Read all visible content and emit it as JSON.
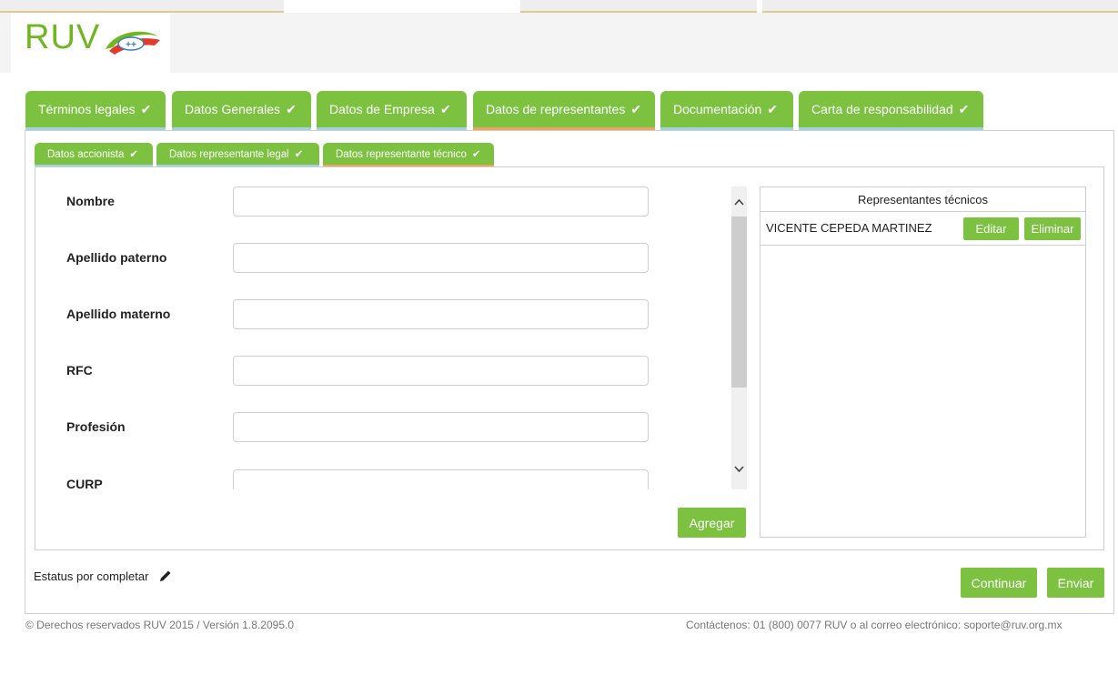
{
  "header": {
    "logo_text": "RUV",
    "logo_badge": "++"
  },
  "main_tabs": [
    {
      "label": "Términos legales",
      "check": "✔"
    },
    {
      "label": "Datos Generales",
      "check": "✔"
    },
    {
      "label": "Datos de Empresa",
      "check": "✔"
    },
    {
      "label": "Datos de representantes",
      "check": "✔",
      "active": true
    },
    {
      "label": "Documentación",
      "check": "✔"
    },
    {
      "label": "Carta de responsabilidad",
      "check": "✔"
    }
  ],
  "sub_tabs": [
    {
      "label": "Datos accionista",
      "check": "✔"
    },
    {
      "label": "Datos representante legal",
      "check": "✔"
    },
    {
      "label": "Datos representante técnico",
      "check": "✔",
      "active": true
    }
  ],
  "form": {
    "fields": [
      {
        "label": "Nombre",
        "value": ""
      },
      {
        "label": "Apellido paterno",
        "value": ""
      },
      {
        "label": "Apellido materno",
        "value": ""
      },
      {
        "label": "RFC",
        "value": ""
      },
      {
        "label": "Profesión",
        "value": ""
      },
      {
        "label": "CURP",
        "value": ""
      }
    ],
    "add_button": "Agregar"
  },
  "representatives": {
    "title": "Representantes técnicos",
    "rows": [
      {
        "name": "VICENTE CEPEDA MARTINEZ",
        "edit": "Editar",
        "delete": "Eliminar"
      }
    ]
  },
  "status": {
    "text": "Estatus por completar"
  },
  "actions": {
    "continue": "Continuar",
    "send": "Enviar"
  },
  "footer": {
    "left": "© Derechos reservados RUV 2015 / Versión 1.8.2095.0",
    "right": "Contáctenos: 01 (800) 0077 RUV o al correo electrónico: soporte@ruv.org.mx"
  },
  "colors": {
    "accent_green": "#7dc141",
    "active_tab_underline": "#f0a35c",
    "tab_underline": "#9fd3e4"
  }
}
